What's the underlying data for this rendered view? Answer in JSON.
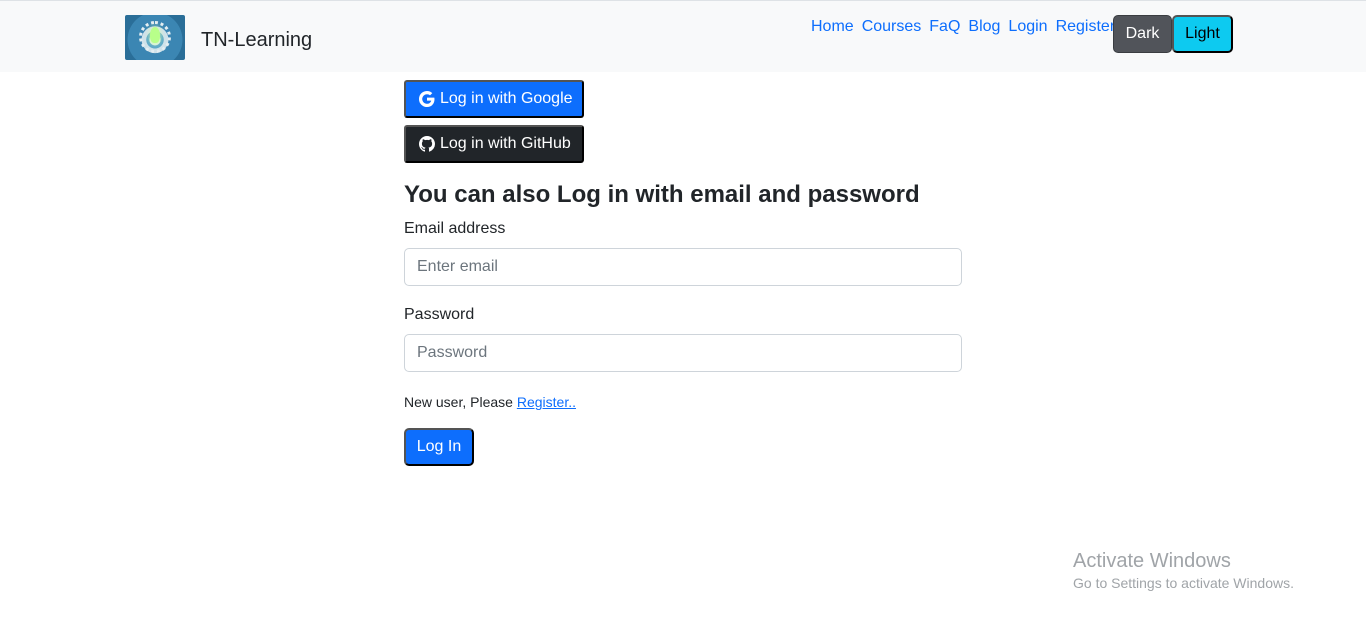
{
  "navbar": {
    "brand_name": "TN-Learning",
    "links": [
      "Home",
      "Courses",
      "FaQ",
      "Blog",
      "Login",
      "Register"
    ],
    "theme_dark_label": "Dark",
    "theme_light_label": "Light"
  },
  "social_login": {
    "google_label": "Log in with Google",
    "github_label": "Log in with GitHub"
  },
  "form": {
    "heading": "You can also Log in with email and password",
    "email_label": "Email address",
    "email_placeholder": "Enter email",
    "password_label": "Password",
    "password_placeholder": "Password",
    "register_prompt": "New user, Please ",
    "register_link": "Register..",
    "submit_label": "Log In"
  },
  "watermark": {
    "title": "Activate Windows",
    "subtitle": "Go to Settings to activate Windows."
  },
  "colors": {
    "primary": "#0d6efd",
    "dark_button": "#51545a",
    "light_button": "#0dcaf0",
    "github_button": "#212529",
    "navbar_bg": "#f8f9fa"
  },
  "icons": {
    "google": "google-icon",
    "github": "github-icon"
  }
}
